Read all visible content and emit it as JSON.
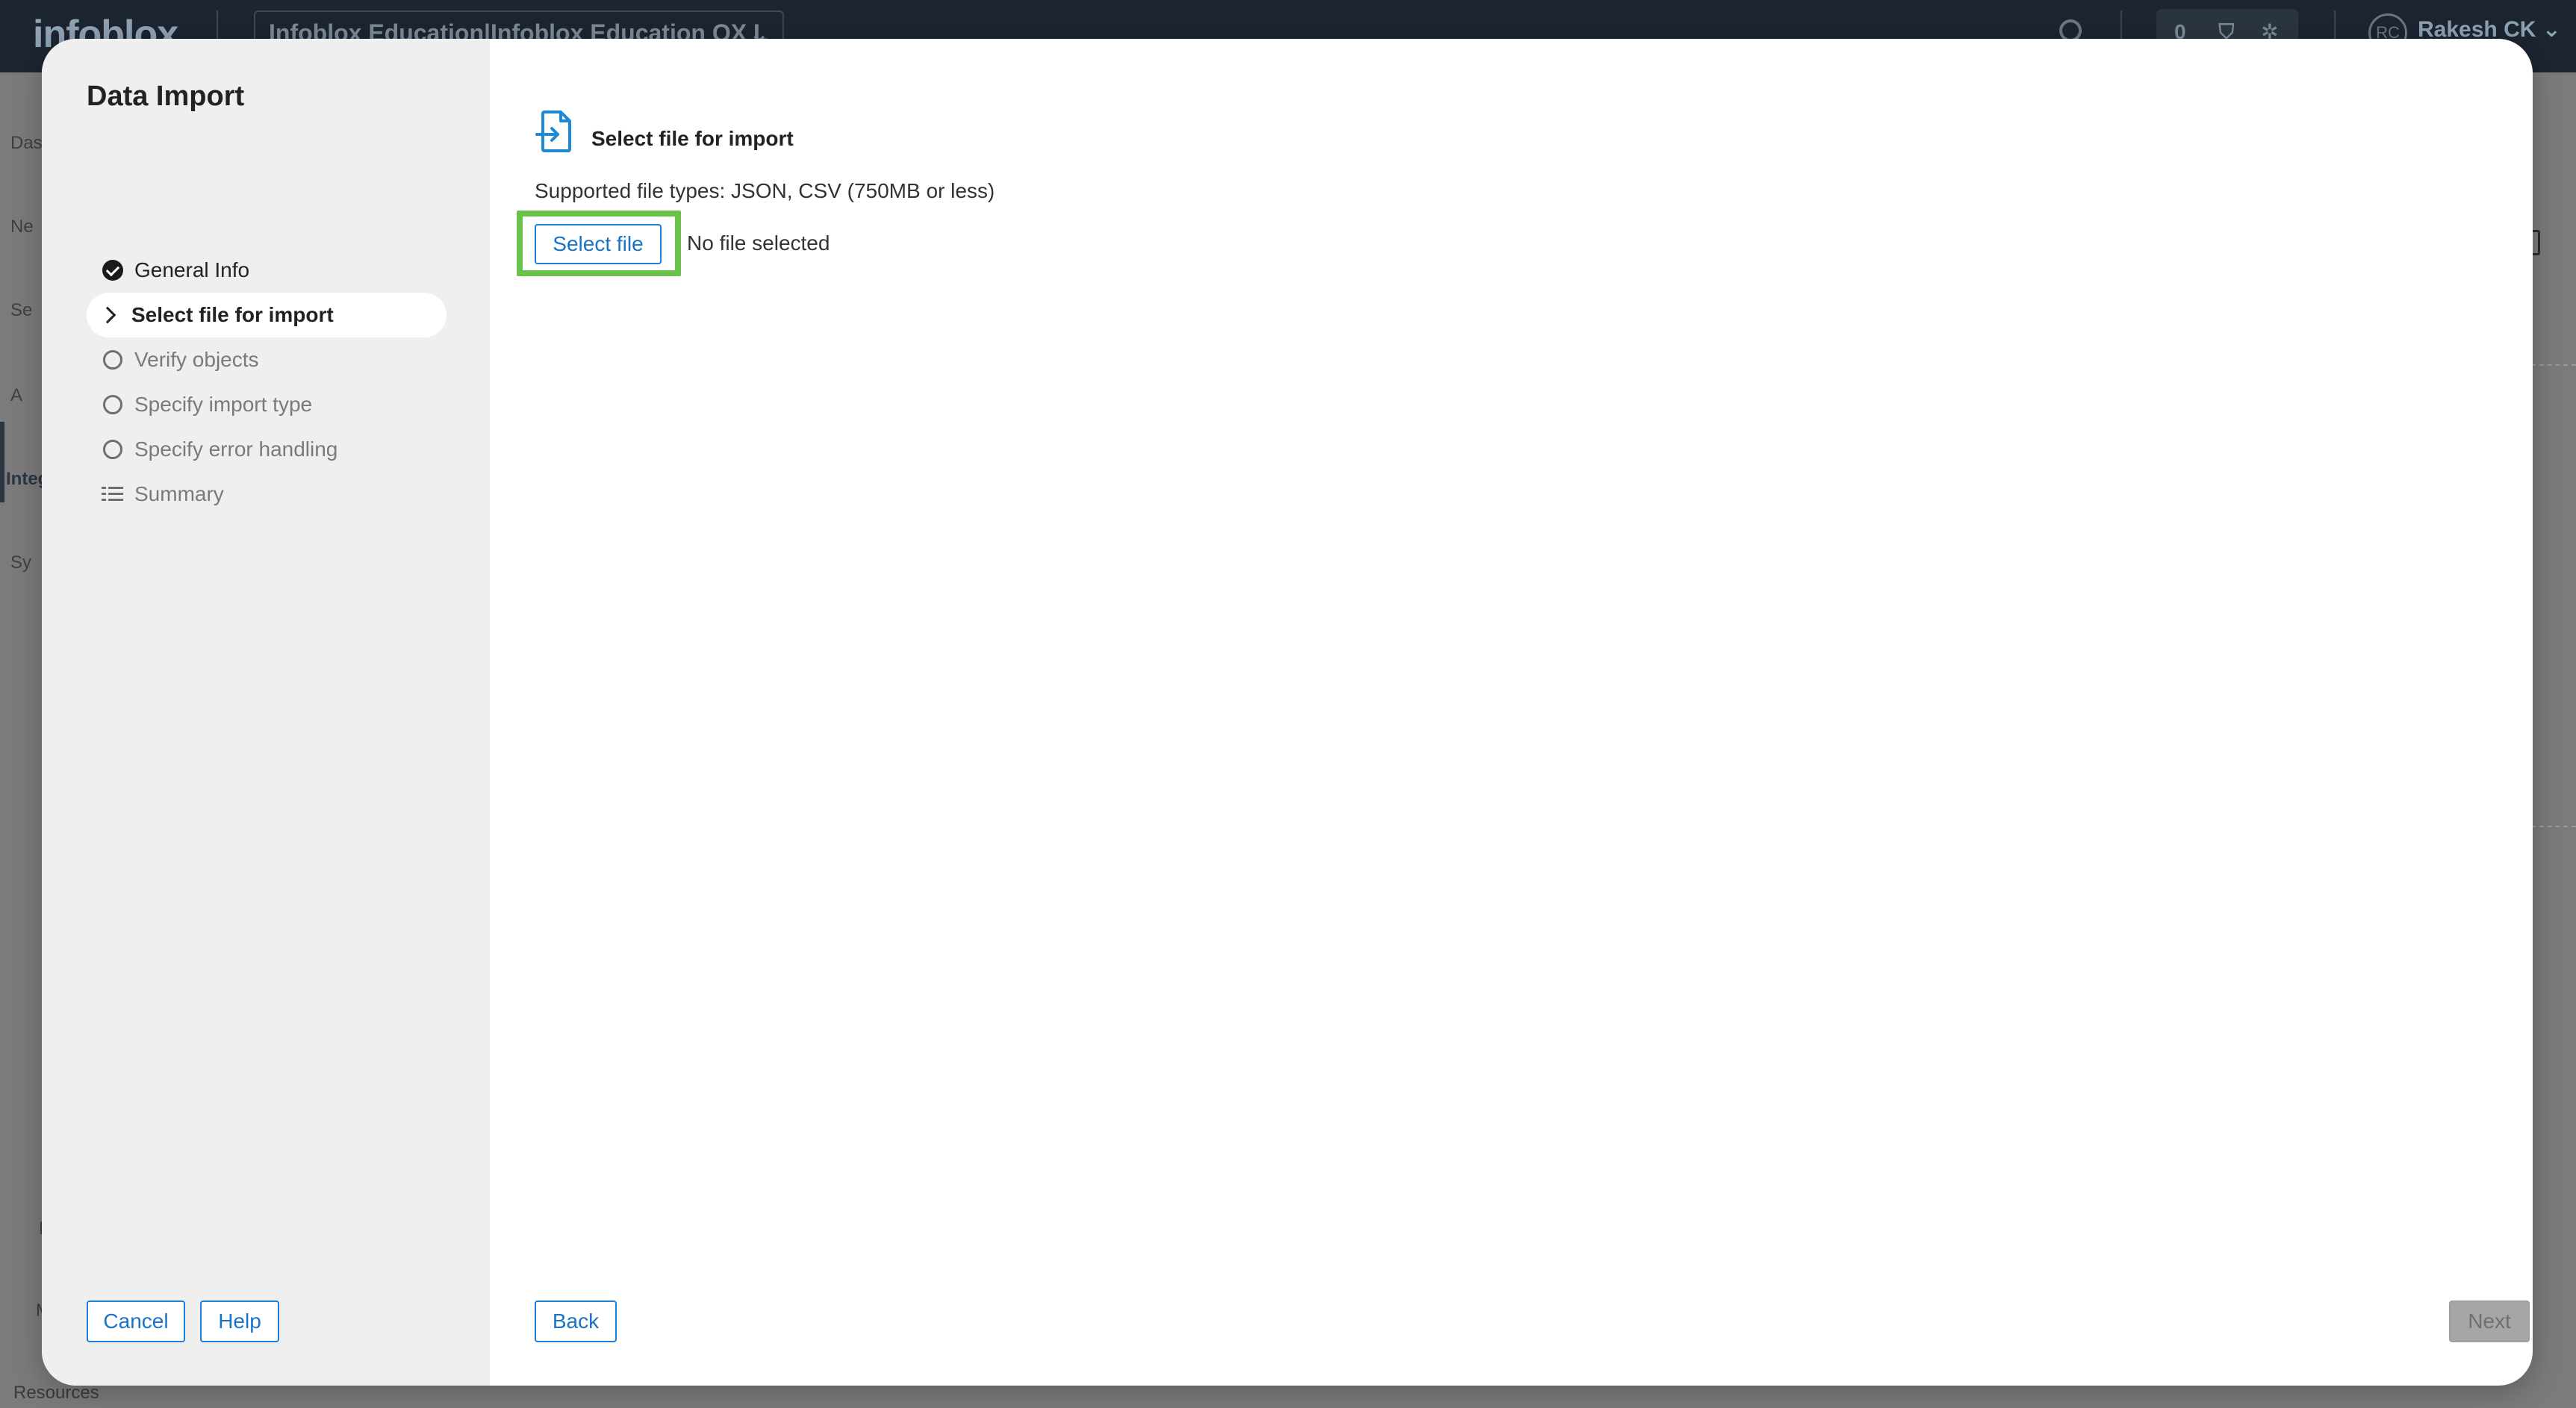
{
  "background": {
    "logo": "infoblox",
    "org_selector": "Infoblox Education|Infoblox Education QX L",
    "notification_count": "0",
    "avatar_initials": "RC",
    "user_name": "Rakesh CK",
    "sidebar_fragments": [
      "Das",
      "Ne",
      "Se",
      "A",
      "Integ",
      "Sy",
      "L",
      "M"
    ],
    "resources_label": "Resources"
  },
  "modal": {
    "title": "Data Import",
    "steps": [
      {
        "label": "General Info",
        "state": "done"
      },
      {
        "label": "Select file for import",
        "state": "active"
      },
      {
        "label": "Verify objects",
        "state": "pending"
      },
      {
        "label": "Specify import type",
        "state": "pending"
      },
      {
        "label": "Specify error handling",
        "state": "pending"
      },
      {
        "label": "Summary",
        "state": "summary"
      }
    ],
    "footer_left": {
      "cancel_label": "Cancel",
      "help_label": "Help"
    },
    "content": {
      "section_title": "Select file for import",
      "supported_types": "Supported file types: JSON, CSV (750MB or less)",
      "select_file_label": "Select file",
      "file_status": "No file selected"
    },
    "footer_right": {
      "back_label": "Back",
      "next_label": "Next"
    }
  },
  "colors": {
    "accent": "#1a73c4",
    "highlight": "#6ac24a",
    "topbar": "#1c2530",
    "left_pane": "#efefef"
  }
}
